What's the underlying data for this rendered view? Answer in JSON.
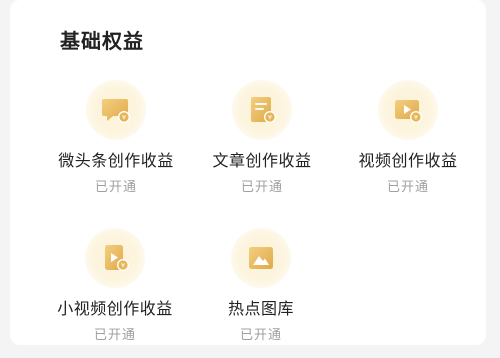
{
  "section": {
    "title": "基础权益"
  },
  "benefits": [
    {
      "label": "微头条创作收益",
      "status": "已开通",
      "icon": "speech-bubble-coin-icon"
    },
    {
      "label": "文章创作收益",
      "status": "已开通",
      "icon": "document-coin-icon"
    },
    {
      "label": "视频创作收益",
      "status": "已开通",
      "icon": "video-coin-icon"
    },
    {
      "label": "小视频创作收益",
      "status": "已开通",
      "icon": "small-video-coin-icon"
    },
    {
      "label": "热点图库",
      "status": "已开通",
      "icon": "image-gallery-icon"
    }
  ],
  "colors": {
    "icon_gold": "#e6b556",
    "icon_gold_light": "#f3cf7f",
    "halo": "#fbf1d4",
    "status_gray": "#a0a0a0"
  }
}
